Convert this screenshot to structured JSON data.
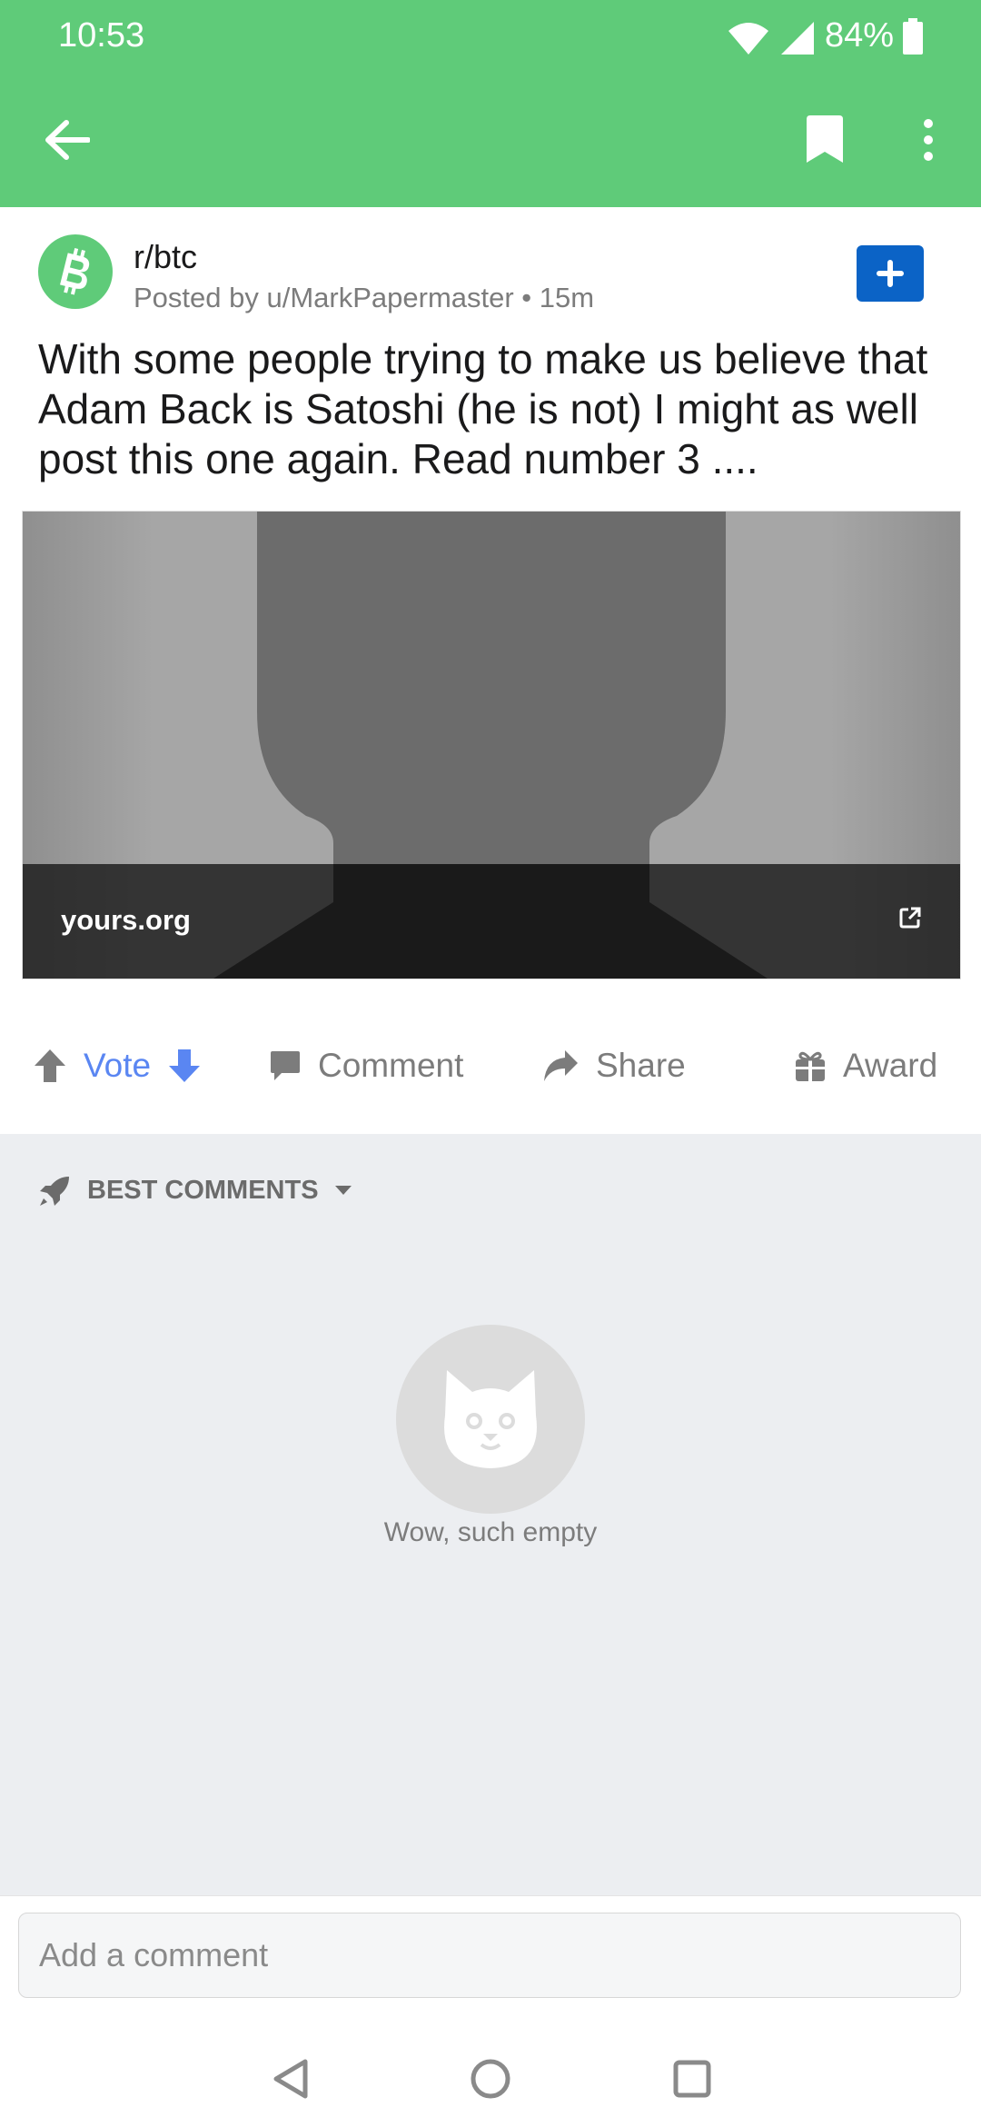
{
  "status_bar": {
    "time": "10:53",
    "battery": "84%"
  },
  "app_bar": {
    "icons": [
      "back-arrow-icon",
      "bookmark-icon",
      "more-vertical-icon"
    ]
  },
  "post": {
    "subreddit": "r/btc",
    "meta": "Posted by u/MarkPapermaster • 15m",
    "title": "With some people trying to make us believe that Adam Back is Satoshi (he is not) I might as well post this one again. Read number 3 ....",
    "link_domain": "yours.org"
  },
  "actions": {
    "vote": "Vote",
    "comment": "Comment",
    "share": "Share",
    "award": "Award"
  },
  "comments": {
    "sort_label": "BEST COMMENTS",
    "empty_text": "Wow, such empty"
  },
  "composer": {
    "placeholder": "Add a comment"
  },
  "colors": {
    "header": "#5fcb79",
    "join_button": "#0b63c6",
    "vote_accent": "#5a86f2"
  }
}
